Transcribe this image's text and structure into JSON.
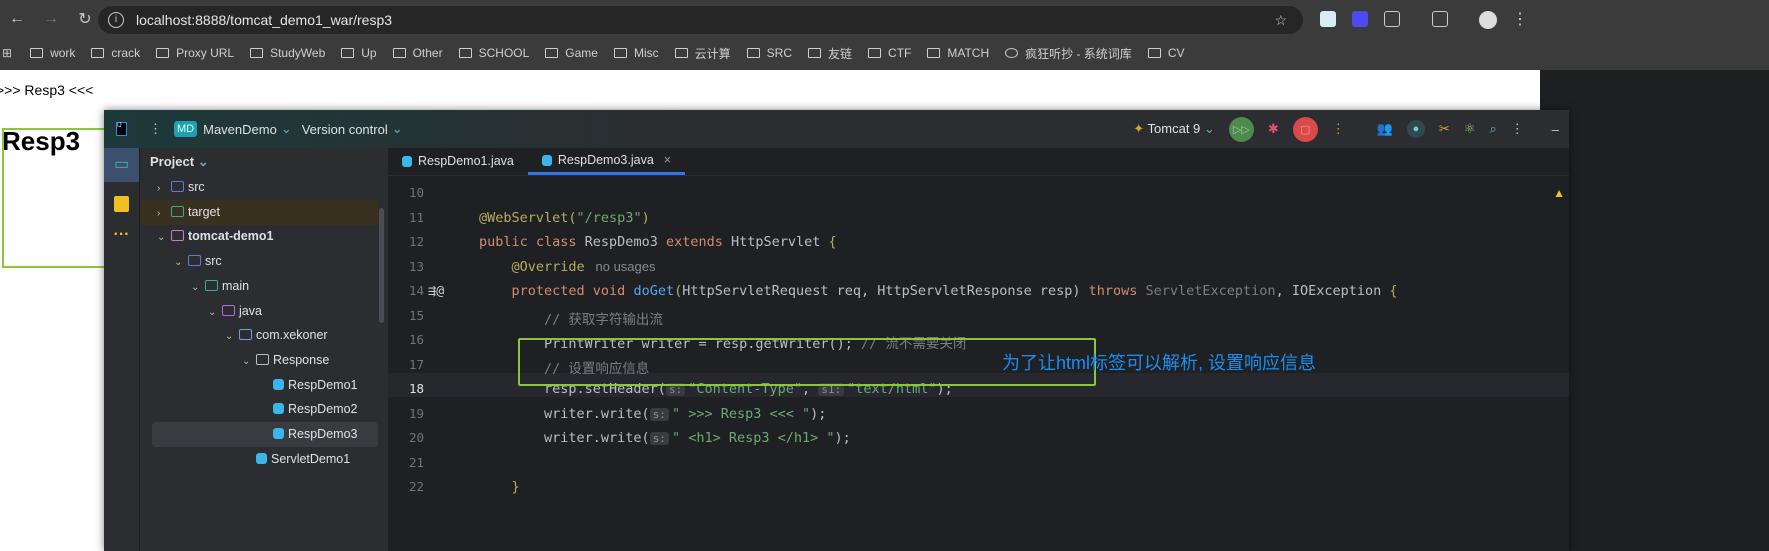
{
  "browser": {
    "url": "localhost:8888/tomcat_demo1_war/resp3",
    "bookmarks": [
      "work",
      "crack",
      "Proxy URL",
      "StudyWeb",
      "Up",
      "Other",
      "SCHOOL",
      "Game",
      "Misc",
      "云计算",
      "SRC",
      "友链",
      "CTF",
      "MATCH",
      "疯狂听抄 - 系统词库",
      "CV"
    ]
  },
  "page": {
    "text": ">>> Resp3 <<<",
    "heading": "Resp3"
  },
  "ide": {
    "project": "MavenDemo",
    "project_badge": "MD",
    "vcs": "Version control",
    "run_config": "Tomcat 9",
    "panel_title": "Project",
    "tree": [
      {
        "label": "src",
        "depth": 1,
        "chev": ">",
        "color": "#5a7bd8"
      },
      {
        "label": "target",
        "depth": 1,
        "chev": ">",
        "color": "#3aa99f",
        "hl": true
      },
      {
        "label": "tomcat-demo1",
        "depth": 1,
        "chev": "v",
        "color": "#c07fd0",
        "bold": true
      },
      {
        "label": "src",
        "depth": 2,
        "chev": "v",
        "color": "#5a7bd8"
      },
      {
        "label": "main",
        "depth": 3,
        "chev": "v",
        "color": "#3aa99f"
      },
      {
        "label": "java",
        "depth": 4,
        "chev": "v",
        "color": "#b36ad8"
      },
      {
        "label": "com.xekoner",
        "depth": 5,
        "chev": "v",
        "color": "#6e9de0"
      },
      {
        "label": "Response",
        "depth": 6,
        "chev": "v",
        "color": "#bbbbbb"
      },
      {
        "label": "RespDemo1",
        "depth": 7,
        "chev": "",
        "color": "#3ab7ea",
        "file": true
      },
      {
        "label": "RespDemo2",
        "depth": 7,
        "chev": "",
        "color": "#3ab7ea",
        "file": true
      },
      {
        "label": "RespDemo3",
        "depth": 7,
        "chev": "",
        "color": "#3ab7ea",
        "file": true,
        "sel": true
      },
      {
        "label": "ServletDemo1",
        "depth": 6,
        "chev": "",
        "color": "#3ab7ea",
        "file": true
      }
    ],
    "tabs": [
      "RespDemo1.java",
      "RespDemo3.java"
    ],
    "close_glyph": "×",
    "code": [
      {
        "n": "10",
        "t": []
      },
      {
        "n": "11",
        "t": [
          [
            "an",
            "@WebServlet("
          ],
          [
            "st",
            "\"/resp3\""
          ],
          [
            "an",
            ")"
          ]
        ]
      },
      {
        "n": "12",
        "t": [
          [
            "kw",
            "public class "
          ],
          [
            "",
            "RespDemo3 "
          ],
          [
            "kw",
            "extends "
          ],
          [
            "",
            "HttpServlet "
          ],
          [
            "an",
            "{"
          ]
        ]
      },
      {
        "n": "13",
        "t": [
          [
            "",
            "    "
          ],
          [
            "an",
            "@Override"
          ],
          [
            "gr",
            "   no usages"
          ]
        ]
      },
      {
        "n": "14",
        "t": [
          [
            "",
            "    "
          ],
          [
            "kw",
            "protected void "
          ],
          [
            "fn",
            "doGet"
          ],
          [
            "an",
            "("
          ],
          [
            "",
            "HttpServletRequest req, HttpServletResponse resp) "
          ],
          [
            "kw",
            "throws "
          ],
          [
            "cm",
            "ServletException"
          ],
          [
            "",
            ", IOException "
          ],
          [
            "an",
            "{"
          ]
        ]
      },
      {
        "n": "15",
        "t": [
          [
            "",
            "        "
          ],
          [
            "cm",
            "// 获取字符输出流"
          ]
        ]
      },
      {
        "n": "16",
        "t": [
          [
            "",
            "        PrintWriter writer = resp.getWriter(); "
          ],
          [
            "cm",
            "// 流不需要关闭"
          ]
        ]
      },
      {
        "n": "17",
        "t": [
          [
            "",
            "        "
          ],
          [
            "cm",
            "// 设置响应信息"
          ]
        ]
      },
      {
        "n": "18",
        "t": [
          [
            "",
            "        resp.setHeader("
          ],
          [
            "hint",
            "s:"
          ],
          [
            "st",
            "\"Content-Type\""
          ],
          [
            "",
            ", "
          ],
          [
            "hint",
            "s1:"
          ],
          [
            "st",
            "\"text/html\""
          ],
          [
            "",
            ");"
          ]
        ]
      },
      {
        "n": "19",
        "t": [
          [
            "",
            "        writer.write("
          ],
          [
            "hint",
            "s:"
          ],
          [
            "st",
            "\" >>> Resp3 <<< \""
          ],
          [
            "",
            ");"
          ]
        ]
      },
      {
        "n": "20",
        "t": [
          [
            "",
            "        writer.write("
          ],
          [
            "hint",
            "s:"
          ],
          [
            "st",
            "\" <h1> Resp3 </h1> \""
          ],
          [
            "",
            ");"
          ]
        ]
      },
      {
        "n": "21",
        "t": []
      },
      {
        "n": "22",
        "t": [
          [
            "",
            "    "
          ],
          [
            "an",
            "}"
          ]
        ]
      }
    ]
  },
  "annotation": "为了让html标签可以解析, 设置响应信息"
}
